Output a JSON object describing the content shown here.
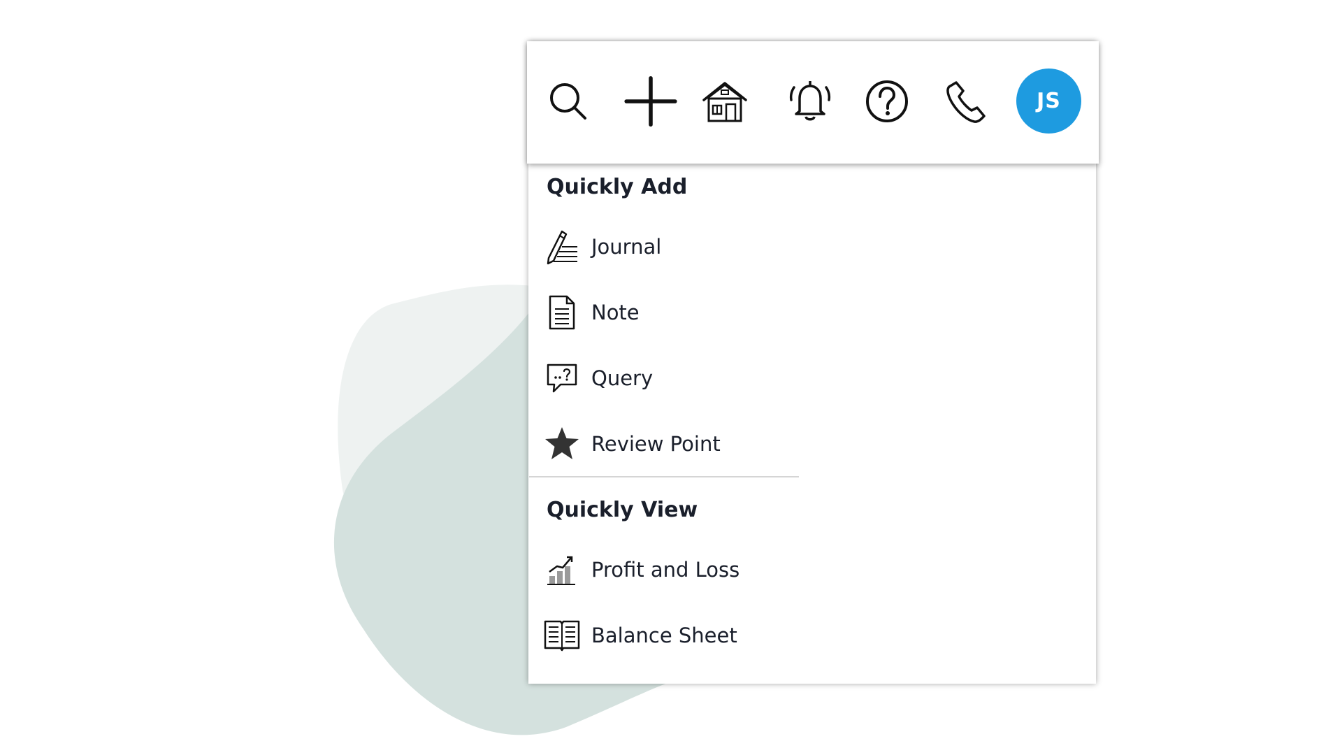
{
  "colors": {
    "avatar_bg": "#1e9be0",
    "text": "#1a1f2b",
    "blob_light": "#eef2f1",
    "blob_dark": "#d4e1de"
  },
  "toolbar": {
    "icons": [
      "search-icon",
      "plus-icon",
      "home-icon",
      "bell-icon",
      "help-icon",
      "phone-icon"
    ],
    "avatar_initials": "JS"
  },
  "menu": {
    "quick_add": {
      "title": "Quickly Add",
      "items": [
        {
          "label": "Journal",
          "icon": "pencil-lines-icon"
        },
        {
          "label": "Note",
          "icon": "document-icon"
        },
        {
          "label": "Query",
          "icon": "speech-bubble-question-icon"
        },
        {
          "label": "Review Point",
          "icon": "star-icon"
        }
      ]
    },
    "quick_view": {
      "title": "Quickly View",
      "items": [
        {
          "label": "Profit and Loss",
          "icon": "bar-chart-icon"
        },
        {
          "label": "Balance Sheet",
          "icon": "open-book-icon"
        }
      ]
    }
  }
}
